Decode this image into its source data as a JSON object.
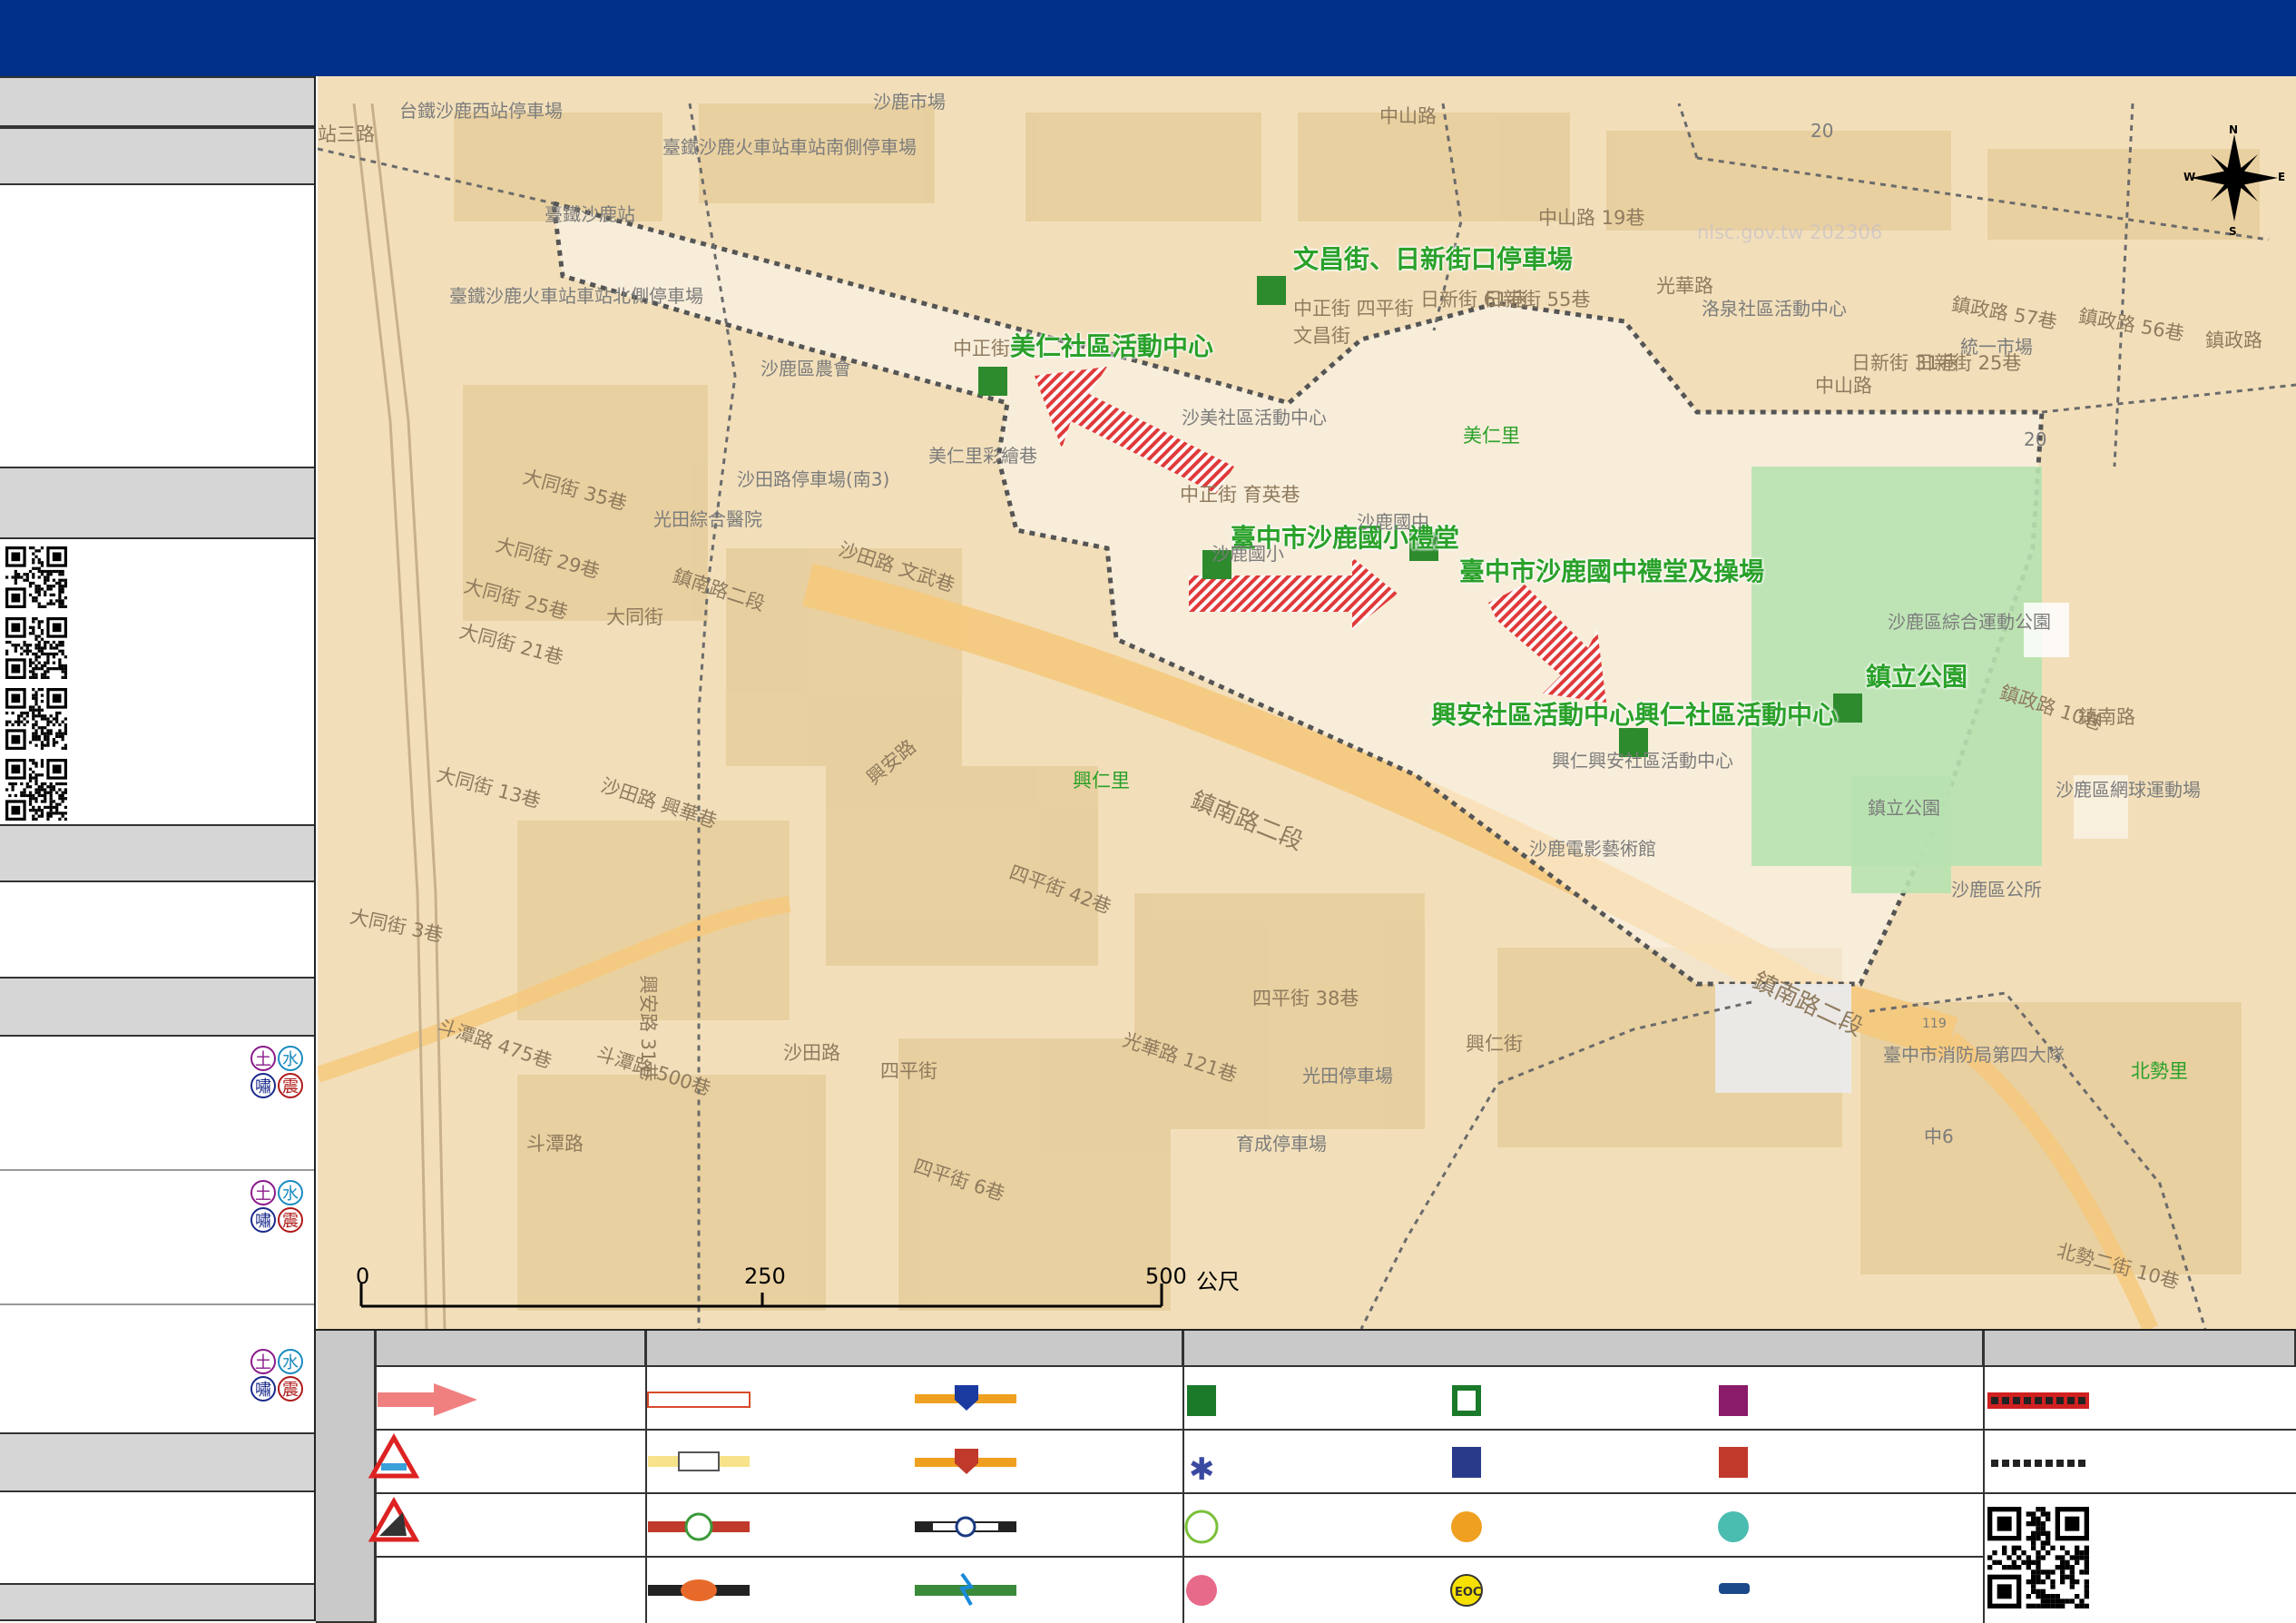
{
  "map": {
    "shelter_labels": [
      {
        "id": "wenchang",
        "text": "文昌街、日新街口停車場"
      },
      {
        "id": "meiren",
        "text": "美仁社區活動中心"
      },
      {
        "id": "shalu-elem",
        "text": "臺中市沙鹿國小禮堂"
      },
      {
        "id": "shalu-junior",
        "text": "臺中市沙鹿國中禮堂及操場"
      },
      {
        "id": "xingan",
        "text": "興安社區活動中心興仁社區活動中心"
      },
      {
        "id": "zhenli-park",
        "text": "鎮立公園"
      }
    ],
    "streets": [
      {
        "id": "s1",
        "text": "台鐵沙鹿西站停車場"
      },
      {
        "id": "s2",
        "text": "沙鹿市場"
      },
      {
        "id": "s3",
        "text": "中山路"
      },
      {
        "id": "s4",
        "text": "臺鐵沙鹿火車站車站南側停車場"
      },
      {
        "id": "s5",
        "text": "臺鐵沙鹿站"
      },
      {
        "id": "s6",
        "text": "臺鐵沙鹿火車站車站北側停車場"
      },
      {
        "id": "s7",
        "text": "沙鹿區農會"
      },
      {
        "id": "s8",
        "text": "美仁里彩繪巷"
      },
      {
        "id": "s9",
        "text": "沙田路停車場(南3)"
      },
      {
        "id": "s10",
        "text": "光田綜合醫院"
      },
      {
        "id": "s11",
        "text": "大同街 35巷"
      },
      {
        "id": "s12",
        "text": "大同街 29巷"
      },
      {
        "id": "s13",
        "text": "大同街 25巷"
      },
      {
        "id": "s14",
        "text": "大同街 21巷"
      },
      {
        "id": "s15",
        "text": "大同街 13巷"
      },
      {
        "id": "s16",
        "text": "大同街 3巷"
      },
      {
        "id": "s17",
        "text": "鎮南路二段"
      },
      {
        "id": "s18",
        "text": "沙田路 文武巷"
      },
      {
        "id": "s19",
        "text": "沙田路 興華巷"
      },
      {
        "id": "s20",
        "text": "興安路"
      },
      {
        "id": "s21",
        "text": "興仁里"
      },
      {
        "id": "s22",
        "text": "鎮南路二段"
      },
      {
        "id": "s23",
        "text": "四平街 42巷"
      },
      {
        "id": "s24",
        "text": "斗潭路 475巷"
      },
      {
        "id": "s25",
        "text": "斗潭路 500巷"
      },
      {
        "id": "s26",
        "text": "興安路 31巷"
      },
      {
        "id": "s27",
        "text": "光華路 121巷"
      },
      {
        "id": "s28",
        "text": "光田停車場"
      },
      {
        "id": "s29",
        "text": "育成停車場"
      },
      {
        "id": "s30",
        "text": "四平街 6巷"
      },
      {
        "id": "s31",
        "text": "沙鹿電影藝術館"
      },
      {
        "id": "s32",
        "text": "興仁興安社區活動中心"
      },
      {
        "id": "s33",
        "text": "鎮立公園"
      },
      {
        "id": "s34",
        "text": "沙鹿區綜合運動公園"
      },
      {
        "id": "s35",
        "text": "鎮政路 10巷"
      },
      {
        "id": "s36",
        "text": "沙鹿區網球運動場"
      },
      {
        "id": "s37",
        "text": "沙鹿區公所"
      },
      {
        "id": "s38",
        "text": "臺中市消防局第四大隊"
      },
      {
        "id": "s39",
        "text": "北勢里"
      },
      {
        "id": "s40",
        "text": "北勢二街 10巷"
      },
      {
        "id": "s41",
        "text": "鎮南路二段"
      },
      {
        "id": "s42",
        "text": "美仁里"
      },
      {
        "id": "s43",
        "text": "沙美社區活動中心"
      },
      {
        "id": "s44",
        "text": "沙鹿國小"
      },
      {
        "id": "s45",
        "text": "沙鹿國中"
      },
      {
        "id": "s46",
        "text": "洛泉社區活動中心"
      },
      {
        "id": "s47",
        "text": "鎮政路 57巷"
      },
      {
        "id": "s48",
        "text": "鎮政路 56巷"
      },
      {
        "id": "s49",
        "text": "統一市場"
      },
      {
        "id": "s50",
        "text": "中正街 育英巷"
      },
      {
        "id": "s51",
        "text": "中正街"
      },
      {
        "id": "s52",
        "text": "中山路 19巷"
      },
      {
        "id": "s53",
        "text": "日新街 61巷"
      },
      {
        "id": "s54",
        "text": "日新街 55巷"
      },
      {
        "id": "s55",
        "text": "光華路"
      },
      {
        "id": "s56",
        "text": "日新街 31巷"
      },
      {
        "id": "s57",
        "text": "日新街 25巷"
      },
      {
        "id": "s58",
        "text": "中正街 四平街"
      },
      {
        "id": "s59",
        "text": "鎮政路"
      },
      {
        "id": "s60",
        "text": "中山路"
      },
      {
        "id": "s61",
        "text": "四平街 38巷"
      },
      {
        "id": "s62",
        "text": "四平街"
      },
      {
        "id": "s63",
        "text": "沙田路"
      },
      {
        "id": "s64",
        "text": "斗潭路"
      },
      {
        "id": "s65",
        "text": "興仁街"
      },
      {
        "id": "s66",
        "text": "中6"
      },
      {
        "id": "s67",
        "text": "20"
      },
      {
        "id": "s68",
        "text": "文昌街"
      },
      {
        "id": "s69",
        "text": "20"
      },
      {
        "id": "s70",
        "text": "大同街"
      },
      {
        "id": "s71",
        "text": "站三路"
      },
      {
        "id": "s72",
        "text": "鎮南路"
      },
      {
        "id": "s73",
        "text": "119"
      }
    ],
    "watermark": "nlsc.gov.tw 202306",
    "compass": {
      "n": "N",
      "s": "S",
      "e": "E",
      "w": "W"
    },
    "scale": {
      "ticks": [
        "0",
        "250",
        "500"
      ],
      "unit": "公尺"
    }
  },
  "hazard_icons": {
    "soil": "土",
    "water": "水",
    "tsunami": "嘯",
    "quake": "震"
  },
  "colors": {
    "header": "#003087",
    "map_bg": "#f2dfba",
    "shelter_green": "#2aa12a",
    "route_red": "#e03a3a",
    "boundary": "#555555"
  }
}
